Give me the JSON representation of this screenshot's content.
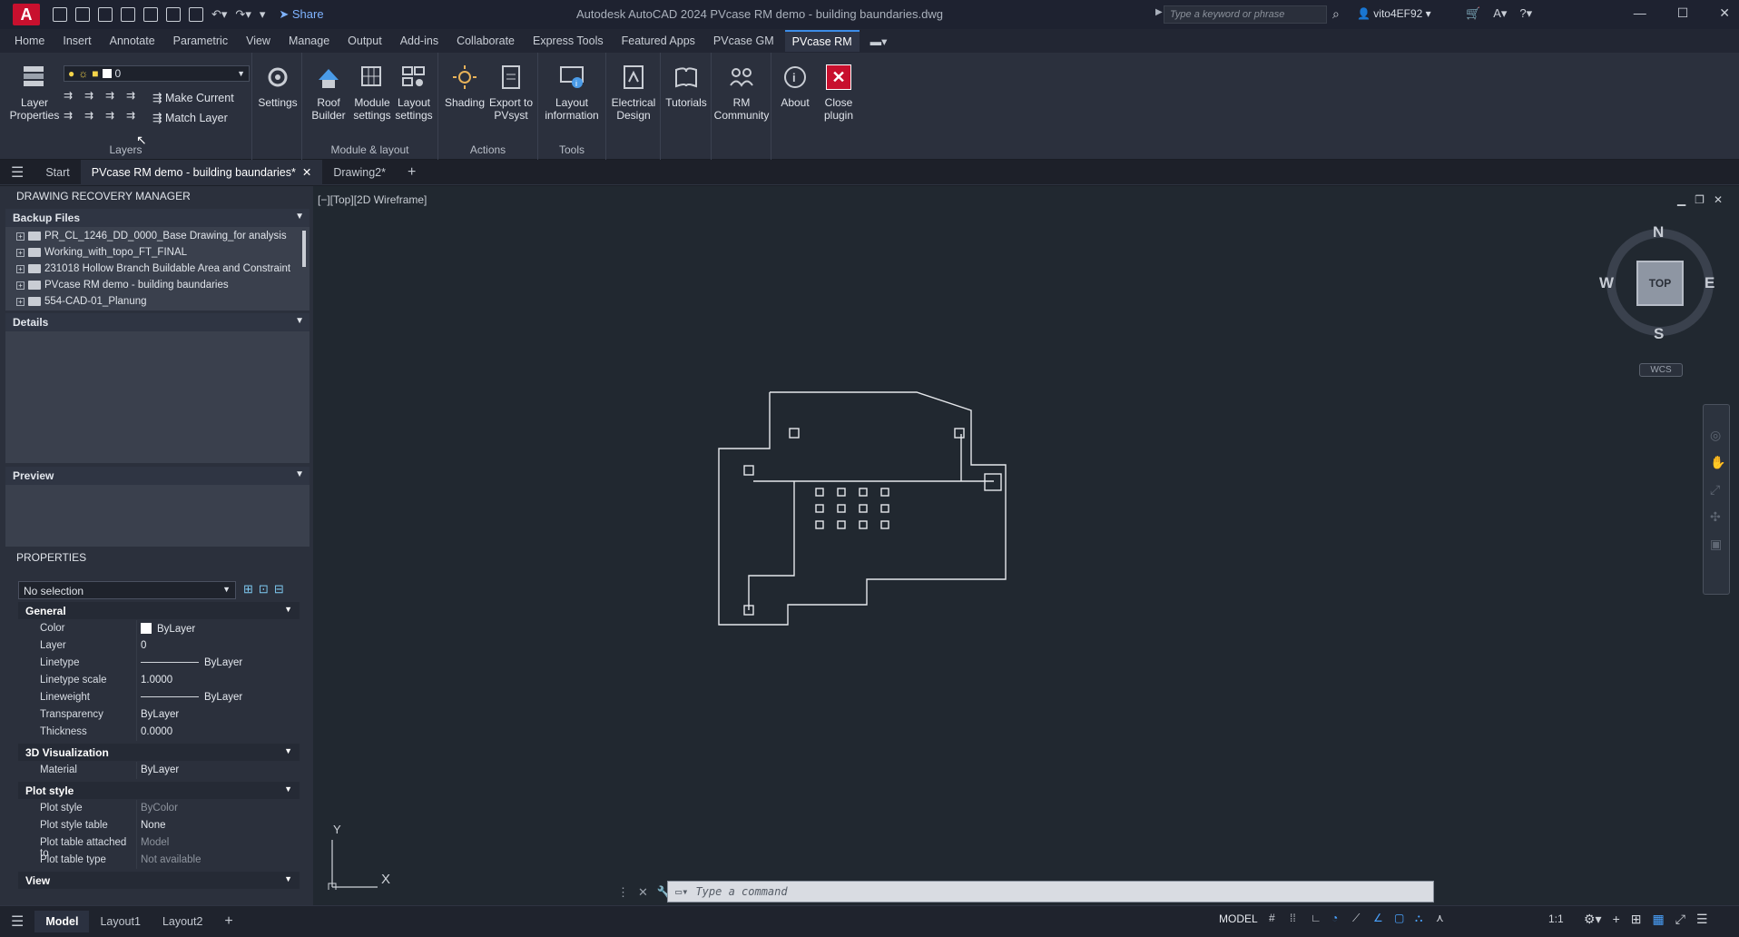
{
  "titlebar": {
    "logo": "A",
    "share": "Share",
    "title": "Autodesk AutoCAD 2024    PVcase RM demo - building baundaries.dwg",
    "search_placeholder": "Type a keyword or phrase",
    "user": "vito4EF92"
  },
  "ribbon_tabs": [
    "Home",
    "Insert",
    "Annotate",
    "Parametric",
    "View",
    "Manage",
    "Output",
    "Add-ins",
    "Collaborate",
    "Express Tools",
    "Featured Apps",
    "PVcase GM",
    "PVcase RM"
  ],
  "ribbon": {
    "layer_properties": "Layer\nProperties",
    "layer_value": "0",
    "make_current": "Make Current",
    "match_layer": "Match Layer",
    "layers_panel": "Layers",
    "settings": "Settings",
    "roof_builder": "Roof\nBuilder",
    "module_settings": "Module\nsettings",
    "layout_settings": "Layout\nsettings",
    "module_layout_panel": "Module & layout",
    "shading": "Shading",
    "export_pvsyst": "Export to\nPVsyst",
    "actions_panel": "Actions",
    "layout_information": "Layout\ninformation",
    "tools_panel": "Tools",
    "electrical_design": "Electrical\nDesign",
    "tutorials": "Tutorials",
    "rm_community": "RM\nCommunity",
    "about": "About",
    "close_plugin": "Close\nplugin"
  },
  "doc_tabs": {
    "start": "Start",
    "active": "PVcase RM demo - building baundaries*",
    "drawing2": "Drawing2*"
  },
  "recovery": {
    "title": "DRAWING RECOVERY MANAGER",
    "backup_files": "Backup Files",
    "files": [
      "PR_CL_1246_DD_0000_Base Drawing_for analysis",
      "Working_with_topo_FT_FINAL",
      "231018 Hollow Branch Buildable Area and Constraint",
      "PVcase RM demo - building baundaries",
      "554-CAD-01_Planung"
    ],
    "details": "Details",
    "preview": "Preview"
  },
  "properties": {
    "title": "PROPERTIES",
    "selection": "No selection",
    "groups": {
      "general": "General",
      "viz": "3D Visualization",
      "plot": "Plot style",
      "view": "View"
    },
    "general_rows": [
      {
        "k": "Color",
        "v": "ByLayer"
      },
      {
        "k": "Layer",
        "v": "0"
      },
      {
        "k": "Linetype",
        "v": "ByLayer"
      },
      {
        "k": "Linetype scale",
        "v": "1.0000"
      },
      {
        "k": "Lineweight",
        "v": "ByLayer"
      },
      {
        "k": "Transparency",
        "v": "ByLayer"
      },
      {
        "k": "Thickness",
        "v": "0.0000"
      }
    ],
    "viz_rows": [
      {
        "k": "Material",
        "v": "ByLayer"
      }
    ],
    "plot_rows": [
      {
        "k": "Plot style",
        "v": "ByColor"
      },
      {
        "k": "Plot style table",
        "v": "None"
      },
      {
        "k": "Plot table attached to",
        "v": "Model"
      },
      {
        "k": "Plot table type",
        "v": "Not available"
      }
    ]
  },
  "viewport": {
    "label": "[−][Top][2D Wireframe]",
    "cube_label": "TOP",
    "n": "N",
    "s": "S",
    "e": "E",
    "w": "W",
    "wcs": "WCS",
    "ucs_y": "Y",
    "ucs_x": "X"
  },
  "command": {
    "placeholder": "Type a command"
  },
  "status": {
    "tabs": [
      "Model",
      "Layout1",
      "Layout2"
    ],
    "mode": "MODEL",
    "scale": "1:1"
  },
  "colors": {
    "accent": "#3c8ce7",
    "close_red": "#c8102e"
  }
}
